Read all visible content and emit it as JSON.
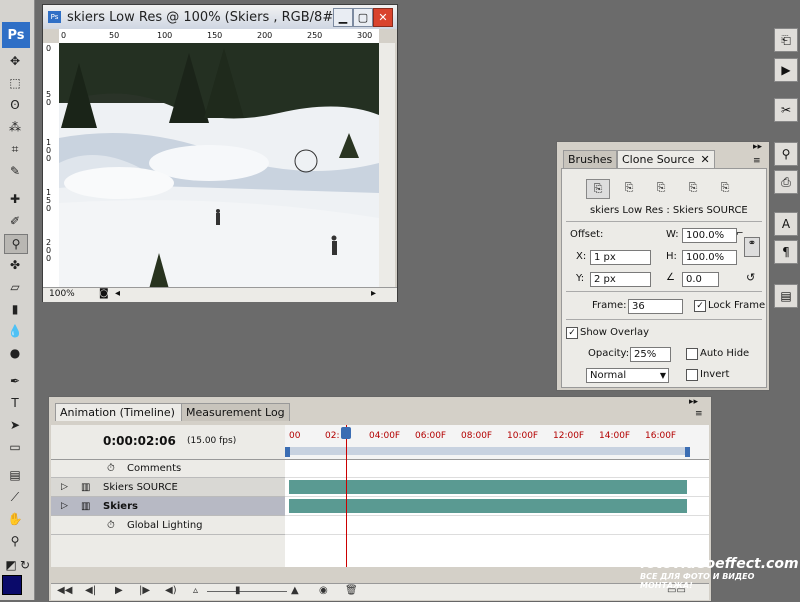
{
  "tools": {
    "logo": "Ps",
    "items": [
      "move-icon",
      "marquee-icon",
      "lasso-icon",
      "magic-wand-icon",
      "crop-icon",
      "slice-icon",
      "healing-brush-icon",
      "brush-icon",
      "clone-stamp-icon",
      "history-brush-icon",
      "eraser-icon",
      "gradient-icon",
      "blur-icon",
      "dodge-icon",
      "pen-icon",
      "type-icon",
      "path-selection-icon",
      "rectangle-icon",
      "notes-icon",
      "eyedropper-icon",
      "hand-icon",
      "zoom-icon"
    ],
    "foreground_color": "#0a0a6a"
  },
  "image_window": {
    "title": "skiers Low Res @ 100% (Skiers , RGB/8#)",
    "ruler_h": [
      "0",
      "50",
      "100",
      "150",
      "200",
      "250",
      "300"
    ],
    "ruler_v": [
      "0",
      "5\n0",
      "1\n0\n0",
      "1\n5\n0",
      "2\n0\n0"
    ],
    "zoom": "100%"
  },
  "dock": {
    "icons": [
      "history-icon",
      "actions-icon",
      "tools-preset-icon",
      "clone-source-icon",
      "character-icon",
      "paragraph-icon",
      "layer-comps-icon"
    ]
  },
  "clone_source": {
    "tabs": [
      "Brushes",
      "Clone Source"
    ],
    "source_name": "skiers Low Res : Skiers SOURCE",
    "offset_label": "Offset:",
    "x_label": "X:",
    "x_value": "1 px",
    "y_label": "Y:",
    "y_value": "2 px",
    "w_label": "W:",
    "w_value": "100.0%",
    "h_label": "H:",
    "h_value": "100.0%",
    "angle_value": "0.0",
    "frame_label": "Frame:",
    "frame_value": "36",
    "lock_frame": "Lock Frame",
    "show_overlay": "Show Overlay",
    "opacity_label": "Opacity:",
    "opacity_value": "25%",
    "auto_hide": "Auto Hide",
    "blend_mode": "Normal",
    "invert": "Invert"
  },
  "animation": {
    "tabs": [
      "Animation (Timeline)",
      "Measurement Log"
    ],
    "timecode": "0:00:02:06",
    "fps": "(15.00 fps)",
    "ticks": [
      "00",
      "02:",
      "04:00F",
      "06:00F",
      "08:00F",
      "10:00F",
      "12:00F",
      "14:00F",
      "16:00F"
    ],
    "layers": [
      {
        "name": "Comments",
        "bold": false
      },
      {
        "name": "Skiers SOURCE",
        "bold": false
      },
      {
        "name": "Skiers",
        "bold": true
      },
      {
        "name": "Global Lighting",
        "bold": false
      }
    ],
    "playhead_fraction": 0.145
  },
  "watermark": {
    "line1": "fotovideoeffect.com",
    "line2": "ВСЕ ДЛЯ ФОТО И ВИДЕО МОНТАЖА!"
  }
}
